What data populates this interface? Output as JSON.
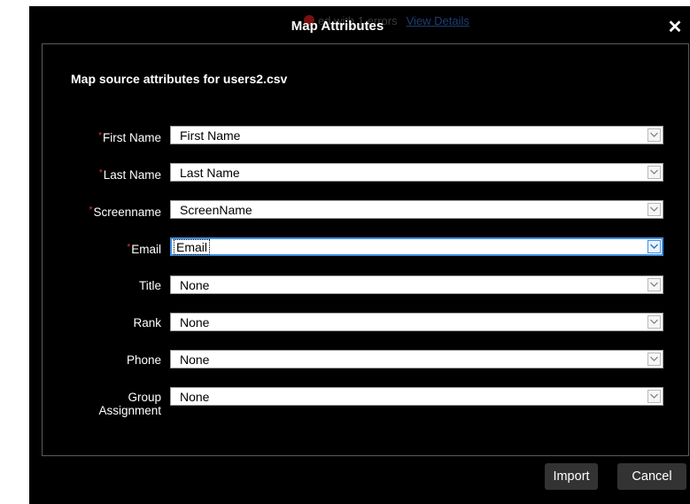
{
  "dialog": {
    "title": "Map Attributes",
    "close_icon": "close-icon",
    "background_notice": {
      "text": "ed with 1 errors",
      "link": "View Details"
    },
    "heading": "Map source attributes for users2.csv",
    "fields": [
      {
        "label": "First Name",
        "required": true,
        "value": "First Name"
      },
      {
        "label": "Last Name",
        "required": true,
        "value": "Last Name"
      },
      {
        "label": "Screenname",
        "required": true,
        "value": "ScreenName"
      },
      {
        "label": "Email",
        "required": true,
        "value": "Email",
        "focused": true
      },
      {
        "label": "Title",
        "required": false,
        "value": "None"
      },
      {
        "label": "Rank",
        "required": false,
        "value": "None"
      },
      {
        "label": "Phone",
        "required": false,
        "value": "None"
      },
      {
        "label": "Group\nAssignment",
        "required": false,
        "value": "None"
      }
    ],
    "required_marker": "*",
    "buttons": {
      "import": "Import",
      "cancel": "Cancel"
    }
  },
  "colors": {
    "dialog_bg": "#000000",
    "required_marker": "#e23a2e",
    "focus_border": "#3d8ee0",
    "button_bg": "#333333"
  }
}
